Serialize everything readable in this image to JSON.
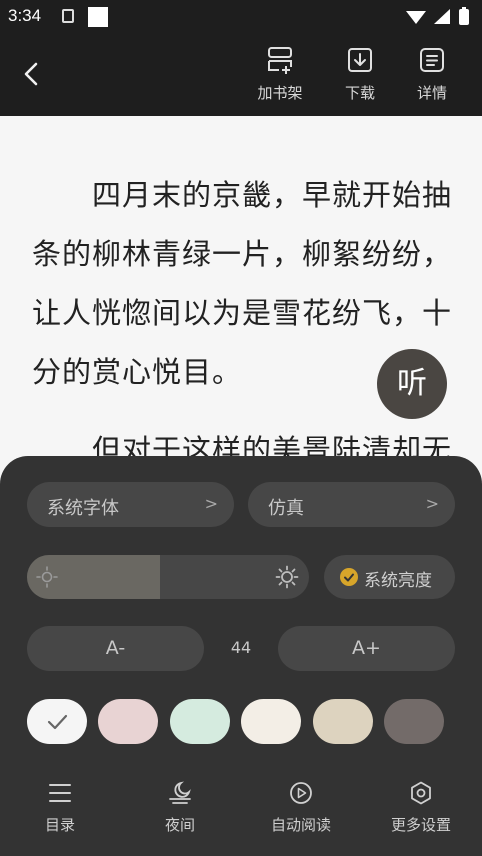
{
  "status_bar": {
    "time": "3:34"
  },
  "header": {
    "back_icon": "chevron-left-icon",
    "actions": [
      {
        "label": "加书架",
        "icon": "bookshelf-add-icon"
      },
      {
        "label": "下载",
        "icon": "download-icon"
      },
      {
        "label": "详情",
        "icon": "details-icon"
      }
    ]
  },
  "reader": {
    "lines": [
      "　　四月末的京畿，早就开始抽",
      "条的柳林青绿一片，柳絮纷纷，",
      "让人恍惚间以为是雪花纷飞，十",
      "分的赏心悦目。",
      "　　但对于这样的美景陆清却无"
    ],
    "listen_label": "听"
  },
  "settings": {
    "font_label": "系统字体",
    "turn_mode_label": "仿真",
    "arrow": ">",
    "brightness_level": 0.47,
    "system_brightness_label": "系统亮度",
    "font_decrease_label": "A-",
    "font_increase_label": "A+",
    "font_size": "44",
    "themes": [
      {
        "color": "#f5f5f5",
        "selected": true
      },
      {
        "color": "#e8d3d3",
        "selected": false
      },
      {
        "color": "#d5ebdf",
        "selected": false
      },
      {
        "color": "#f3eee6",
        "selected": false
      },
      {
        "color": "#ddd3bf",
        "selected": false
      },
      {
        "color": "#736b69",
        "selected": false
      }
    ],
    "accent": "#d7a52a"
  },
  "bottom_nav": [
    {
      "label": "目录",
      "icon": "menu-list-icon"
    },
    {
      "label": "夜间",
      "icon": "night-mode-icon"
    },
    {
      "label": "自动阅读",
      "icon": "auto-read-icon"
    },
    {
      "label": "更多设置",
      "icon": "settings-icon"
    }
  ]
}
